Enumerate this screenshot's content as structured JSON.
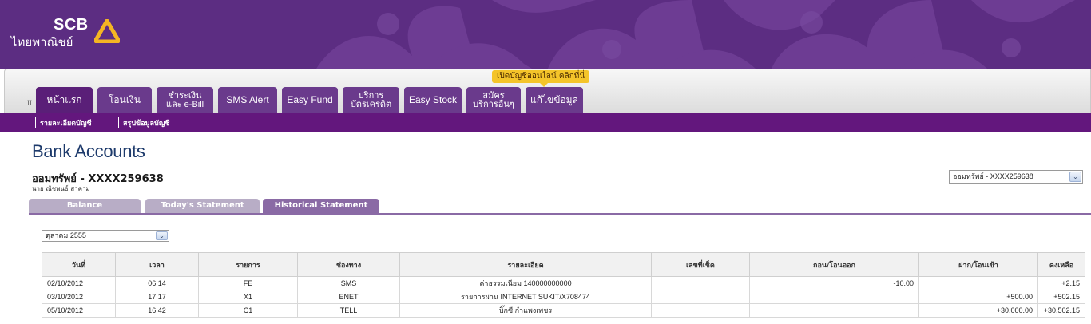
{
  "brand": {
    "name": "SCB",
    "name_th": "ไทยพาณิชย์"
  },
  "promo": "เปิดบัญชีออนไลน์ คลิกที่นี่",
  "nav": {
    "marker": "II",
    "tabs": [
      {
        "label": "หน้าแรก",
        "active": true
      },
      {
        "label": "โอนเงิน"
      },
      {
        "label": "ชำระเงิน\nและ e-Bill"
      },
      {
        "label": "SMS Alert"
      },
      {
        "label": "Easy Fund"
      },
      {
        "label": "บริการ\nบัตรเครดิต"
      },
      {
        "label": "Easy Stock"
      },
      {
        "label": "สมัคร\nบริการอื่นๆ"
      },
      {
        "label": "แก้ไขข้อมูล"
      }
    ]
  },
  "subnav": {
    "items": [
      "รายละเอียดบัญชี",
      "สรุปข้อมูลบัญชี"
    ]
  },
  "page": {
    "title": "Bank Accounts",
    "account_name": "ออมทรัพย์ - XXXX259638",
    "owner": "นาย ณัชพนธ์ สาคาม",
    "account_select": "ออมทรัพย์ - XXXX259638"
  },
  "statement_tabs": [
    {
      "label": "Balance",
      "active": false
    },
    {
      "label": "Today's Statement",
      "active": false
    },
    {
      "label": "Historical Statement",
      "active": true
    }
  ],
  "month_select": "ตุลาคม 2555",
  "table": {
    "headers": [
      "วันที่",
      "เวลา",
      "รายการ",
      "ช่องทาง",
      "รายละเอียด",
      "เลขที่เช็ค",
      "ถอน/โอนออก",
      "ฝาก/โอนเข้า",
      "คงเหลือ"
    ],
    "rows": [
      [
        "02/10/2012",
        "06:14",
        "FE",
        "SMS",
        "ค่าธรรมเนียม 140000000000",
        "",
        "-10.00",
        "",
        "+2.15"
      ],
      [
        "03/10/2012",
        "17:17",
        "X1",
        "ENET",
        "รายการผ่าน INTERNET SUKIT/X708474",
        "",
        "",
        "+500.00",
        "+502.15"
      ],
      [
        "05/10/2012",
        "16:42",
        "C1",
        "TELL",
        "บิ๊กซี กำแพงเพชร",
        "",
        "",
        "+30,000.00",
        "+30,502.15"
      ]
    ]
  },
  "colors": {
    "brand_purple": "#5c2d82",
    "subnav_purple": "#63177d",
    "tab_active": "#8a6aa5",
    "promo_yellow": "#f4c42a",
    "title_blue": "#1d3a6b"
  },
  "icons": {
    "logo": "scb-logo-icon",
    "dropdown": "chevron-down-icon"
  }
}
